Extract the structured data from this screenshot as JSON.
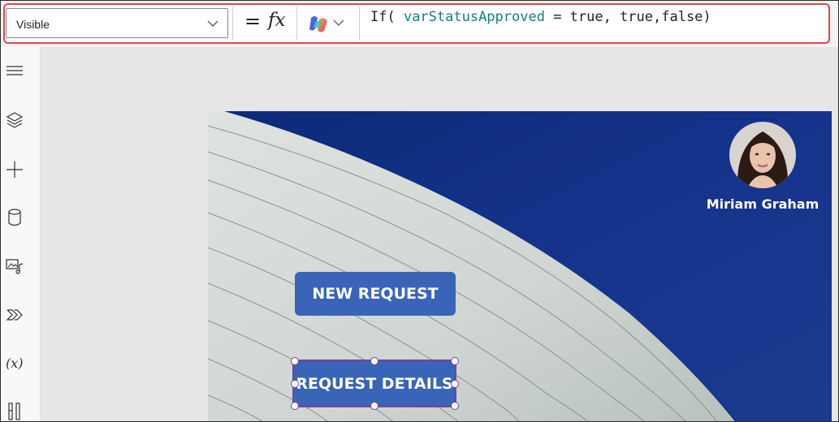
{
  "formula_bar": {
    "property": "Visible",
    "equals": "=",
    "fx": "fx",
    "formula_fn": "If( ",
    "formula_var": "varStatusApproved",
    "formula_rest": " = true, true,false)"
  },
  "screen": {
    "user_name": "Miriam Graham",
    "new_request_label": "NEW REQUEST",
    "request_details_label": "REQUEST DETAILS"
  },
  "rail_icons": [
    "menu-icon",
    "layers-icon",
    "insert-icon",
    "data-icon",
    "media-icon",
    "power-automate-icon",
    "variables-icon",
    "tools-icon"
  ],
  "colors": {
    "button": "#3a64b8",
    "selection": "#7c3f9f",
    "highlight": "#e0474c",
    "sky": "#0f2f7a"
  }
}
